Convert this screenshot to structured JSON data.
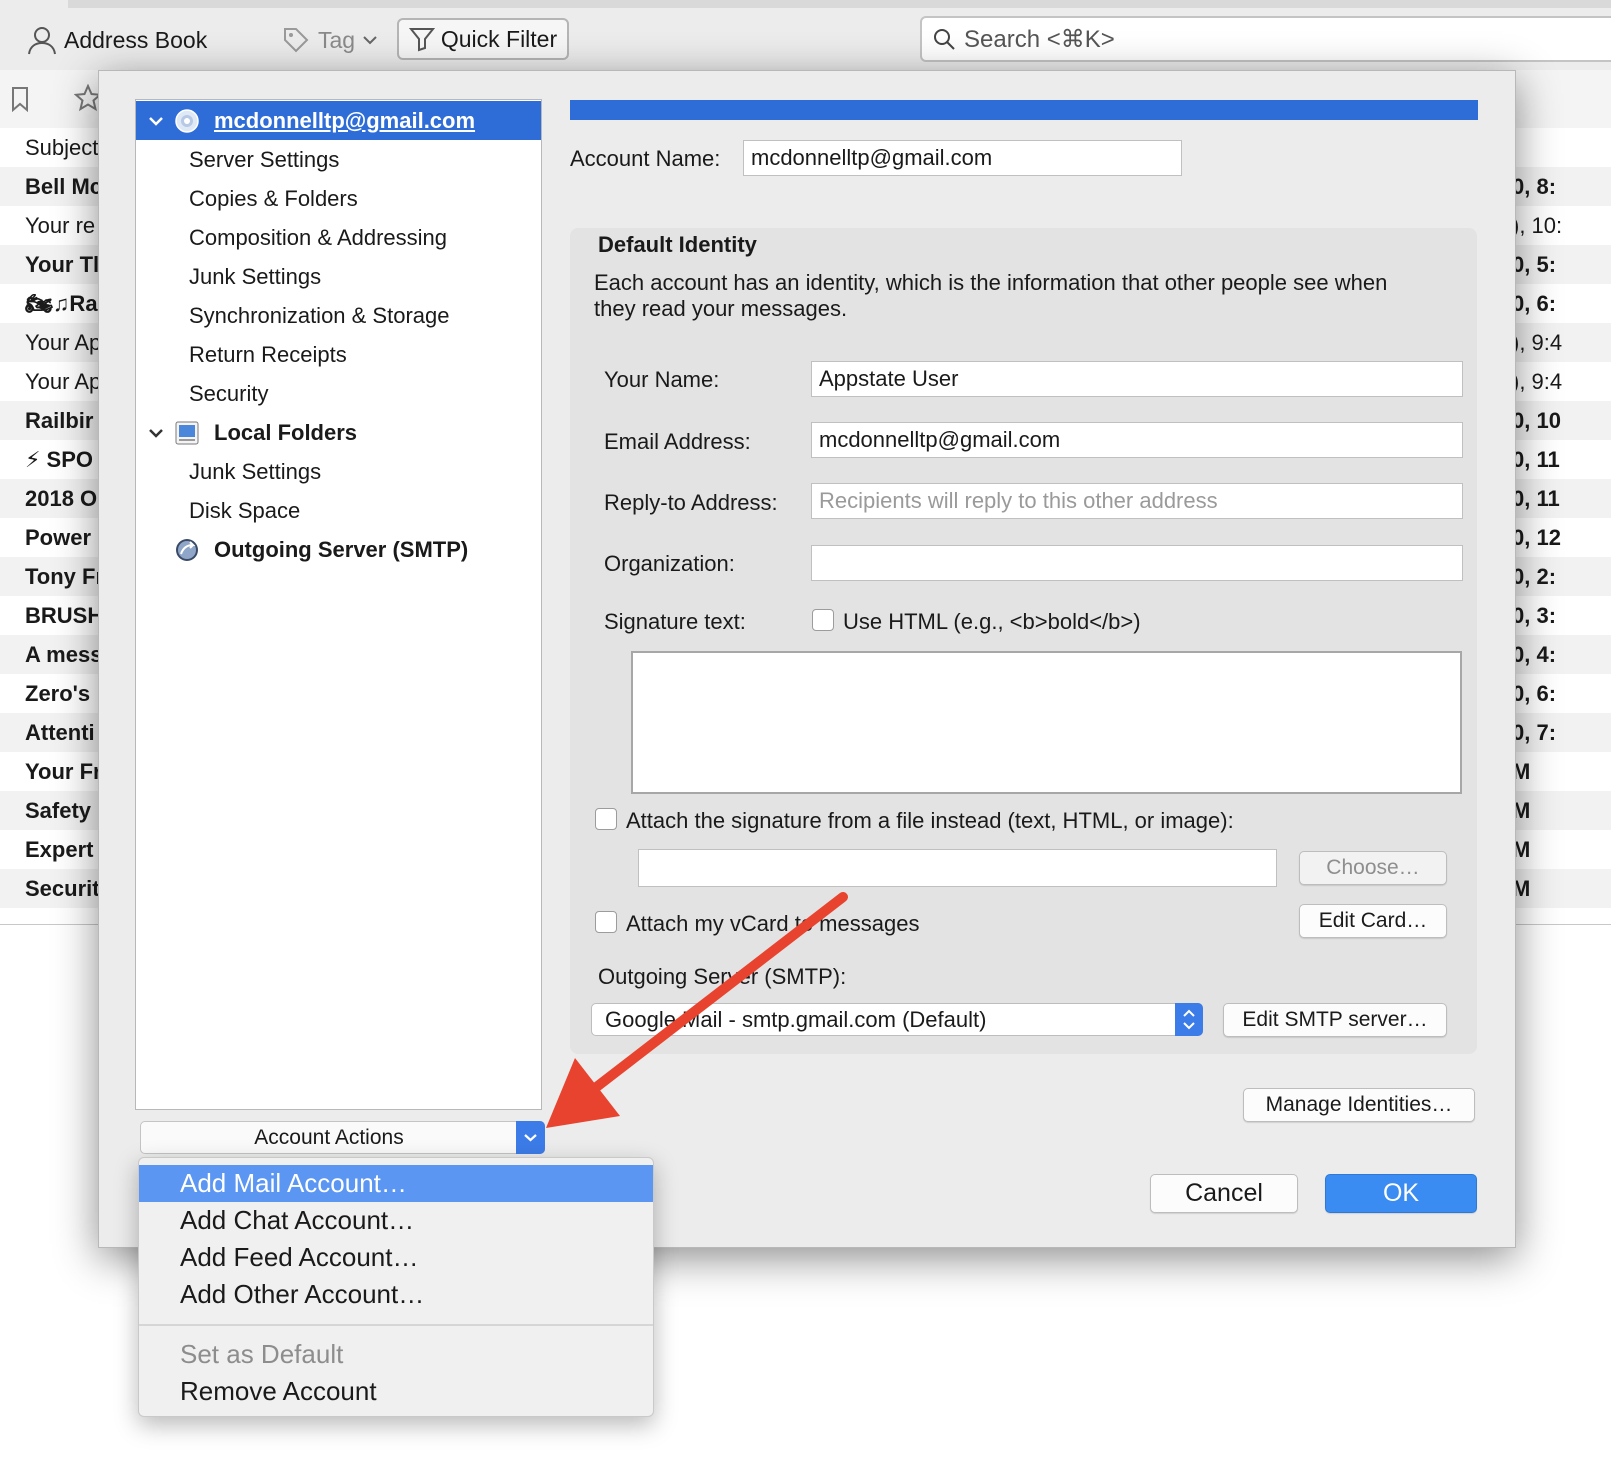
{
  "toolbar": {
    "address_book": "Address Book",
    "tag": "Tag",
    "quick_filter": "Quick Filter",
    "search_placeholder": "Search <⌘K>"
  },
  "message_list": {
    "header_subject": "Subject",
    "rows": [
      {
        "subject": "Bell Mc",
        "date": "0, 8:",
        "unread": true
      },
      {
        "subject": "Your re",
        "date": "), 10:",
        "unread": false
      },
      {
        "subject": "Your Tl",
        "date": "0, 5:",
        "unread": true
      },
      {
        "subject": "🏍♫Ra",
        "date": "0, 6:",
        "unread": true
      },
      {
        "subject": "Your Ap",
        "date": "), 9:4",
        "unread": false
      },
      {
        "subject": "Your Ap",
        "date": "), 9:4",
        "unread": false
      },
      {
        "subject": "Railbir",
        "date": "0, 10",
        "unread": true
      },
      {
        "subject": "⚡ SPO",
        "date": "0, 11",
        "unread": true
      },
      {
        "subject": "2018 O",
        "date": "0, 11",
        "unread": true
      },
      {
        "subject": "Power",
        "date": "0, 12",
        "unread": true
      },
      {
        "subject": "Tony Fr",
        "date": "0, 2:",
        "unread": true
      },
      {
        "subject": "BRUSH",
        "date": "0, 3:",
        "unread": true
      },
      {
        "subject": "A mess",
        "date": "0, 4:",
        "unread": true
      },
      {
        "subject": "Zero's",
        "date": "0, 6:",
        "unread": true
      },
      {
        "subject": "Attenti",
        "date": "0, 7:",
        "unread": true
      },
      {
        "subject": "Your Fr",
        "date": "M",
        "unread": true
      },
      {
        "subject": "Safety",
        "date": "M",
        "unread": true
      },
      {
        "subject": "Expert",
        "date": "M",
        "unread": true
      },
      {
        "subject": "Securit",
        "date": "M",
        "unread": true
      }
    ]
  },
  "account_tree": {
    "account_email": "mcdonnelltp@gmail.com",
    "account_children": [
      "Server Settings",
      "Copies & Folders",
      "Composition & Addressing",
      "Junk Settings",
      "Synchronization & Storage",
      "Return Receipts",
      "Security"
    ],
    "local_folders": "Local Folders",
    "local_children": [
      "Junk Settings",
      "Disk Space"
    ],
    "outgoing_server": "Outgoing Server (SMTP)"
  },
  "account_actions": {
    "label": "Account Actions",
    "menu": {
      "add_mail": "Add Mail Account…",
      "add_chat": "Add Chat Account…",
      "add_feed": "Add Feed Account…",
      "add_other": "Add Other Account…",
      "set_default": "Set as Default",
      "remove": "Remove Account"
    }
  },
  "settings": {
    "account_name_label": "Account Name:",
    "account_name_value": "mcdonnelltp@gmail.com",
    "default_identity_title": "Default Identity",
    "default_identity_desc_1": "Each account has an identity, which is the information that other people see when",
    "default_identity_desc_2": "they read your messages.",
    "your_name_label": "Your Name:",
    "your_name_value": "Appstate User",
    "email_label": "Email Address:",
    "email_value": "mcdonnelltp@gmail.com",
    "reply_to_label": "Reply-to Address:",
    "reply_to_placeholder": "Recipients will reply to this other address",
    "organization_label": "Organization:",
    "organization_value": "",
    "signature_label": "Signature text:",
    "use_html_label": "Use HTML (e.g., <b>bold</b>)",
    "attach_signature_label": "Attach the signature from a file instead (text, HTML, or image):",
    "choose_button": "Choose…",
    "attach_vcard_label": "Attach my vCard to messages",
    "edit_card_button": "Edit Card…",
    "outgoing_server_label": "Outgoing Server (SMTP):",
    "outgoing_server_value": "Google Mail - smtp.gmail.com (Default)",
    "edit_smtp_button": "Edit SMTP server…",
    "manage_identities_button": "Manage Identities…",
    "cancel_button": "Cancel",
    "ok_button": "OK"
  },
  "colors": {
    "selection_blue": "#2e6cd8",
    "menu_highlight": "#5b96f2",
    "ok_blue": "#3b8cf2",
    "annotation_arrow": "#e8432e"
  }
}
